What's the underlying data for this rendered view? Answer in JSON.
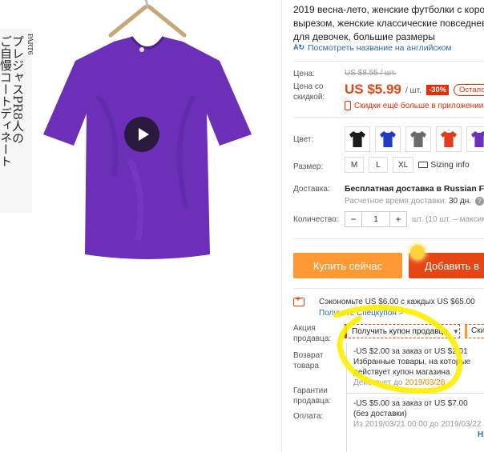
{
  "gallery": {
    "jp_lines": [
      "PART6",
      "プレジャスPR8人の",
      "ご自慢コートディネート"
    ],
    "video_icon": "play-icon"
  },
  "product": {
    "title_lines": [
      "2019 весна-лето, женские футболки с корот",
      "вырезом, женские классические повседнев",
      "для девочек, большие размеры"
    ],
    "translate_link": "Посмотреть название на английском",
    "price_label": "Цена:",
    "old_price": "US $8.55 / шт.",
    "discount_label": "Цена со скидкой:",
    "price": "US $5.99",
    "per_unit": "/ шт.",
    "discount": "-30%",
    "remain_badge": "Остало",
    "app_deal": "Скидки ещё больше в приложении"
  },
  "options": {
    "color_label": "Цвет:",
    "colors": [
      {
        "name": "black",
        "hex": "#1c1c1c"
      },
      {
        "name": "blue",
        "hex": "#1f3bc4"
      },
      {
        "name": "gray",
        "hex": "#6b6b6b"
      },
      {
        "name": "red",
        "hex": "#e23a1c"
      },
      {
        "name": "purple",
        "hex": "#6e2fbf"
      }
    ],
    "size_label": "Размер:",
    "sizes": [
      "M",
      "L",
      "XL"
    ],
    "sizing_info": "Sizing info"
  },
  "shipping": {
    "label": "Доставка:",
    "method": "Бесплатная доставка в Russian Feder",
    "eta_prefix": "Расчетное время доставки:",
    "eta_value": "30 дн."
  },
  "quantity": {
    "label": "Количество:",
    "value": "1",
    "minus": "−",
    "plus": "+",
    "note": "шт. (10 шт. – максиму"
  },
  "actions": {
    "buy_now": "Купить сейчас",
    "add_to_cart": "Добавить в"
  },
  "coupons": {
    "save_text": "Сэкономьте US $6.00 с каждых US $65.00",
    "special_link": "Получите Спецкупон >",
    "seller_promo_label": "Акция продавца:",
    "seller_coupon_select": "Получить купон продавца",
    "other_select": "Ски",
    "returns_label": "Возврат товара",
    "guarantee_label": "Гарантии продавца:",
    "payment_label": "Оплата:",
    "coupon1": {
      "line1": "-US $2.00 за заказ от US $2.01",
      "line2": "Избранные товары, на которые",
      "line3": "действует купон магазина",
      "valid_prefix": "Действует до",
      "valid_date": "2019/03/28"
    },
    "coupon2": {
      "line1": "-US $5.00 за заказ от US $7.00",
      "line2": "(без доставки)",
      "line3": "Из 2019/03/21 00:00 до 2019/03/22 23",
      "link": "НА"
    }
  }
}
